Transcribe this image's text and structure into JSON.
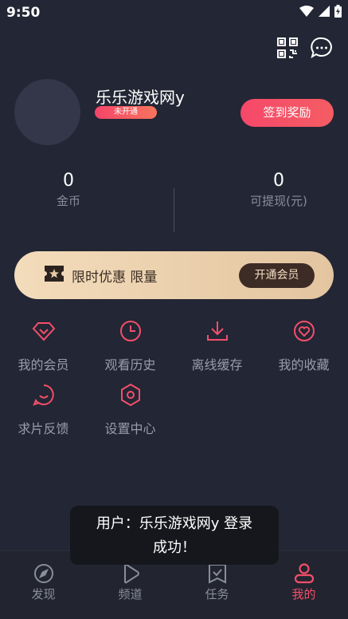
{
  "status_bar": {
    "time": "9:50"
  },
  "profile": {
    "username": "乐乐游戏网y",
    "vip_status": "未开通",
    "checkin_label": "签到奖励"
  },
  "stats": {
    "coins_value": "0",
    "coins_label": "金币",
    "withdraw_value": "0",
    "withdraw_label": "可提现(元)"
  },
  "vip_banner": {
    "promo_text": "限时优惠 限量",
    "button_label": "开通会员"
  },
  "menu": [
    {
      "label": "我的会员",
      "icon": "diamond-icon"
    },
    {
      "label": "观看历史",
      "icon": "clock-icon"
    },
    {
      "label": "离线缓存",
      "icon": "download-icon"
    },
    {
      "label": "我的收藏",
      "icon": "heart-icon"
    },
    {
      "label": "求片反馈",
      "icon": "chat-icon"
    },
    {
      "label": "设置中心",
      "icon": "settings-icon"
    }
  ],
  "toast": {
    "line1": "用户：乐乐游戏网y 登录",
    "line2": "成功！"
  },
  "bottom_nav": [
    {
      "label": "发现",
      "icon": "compass-icon",
      "active": false
    },
    {
      "label": "频道",
      "icon": "play-icon",
      "active": false
    },
    {
      "label": "任务",
      "icon": "task-icon",
      "active": false
    },
    {
      "label": "我的",
      "icon": "user-icon",
      "active": true
    }
  ],
  "colors": {
    "accent": "#f44e6b",
    "background": "#232634",
    "gold": "#e8cba6"
  }
}
